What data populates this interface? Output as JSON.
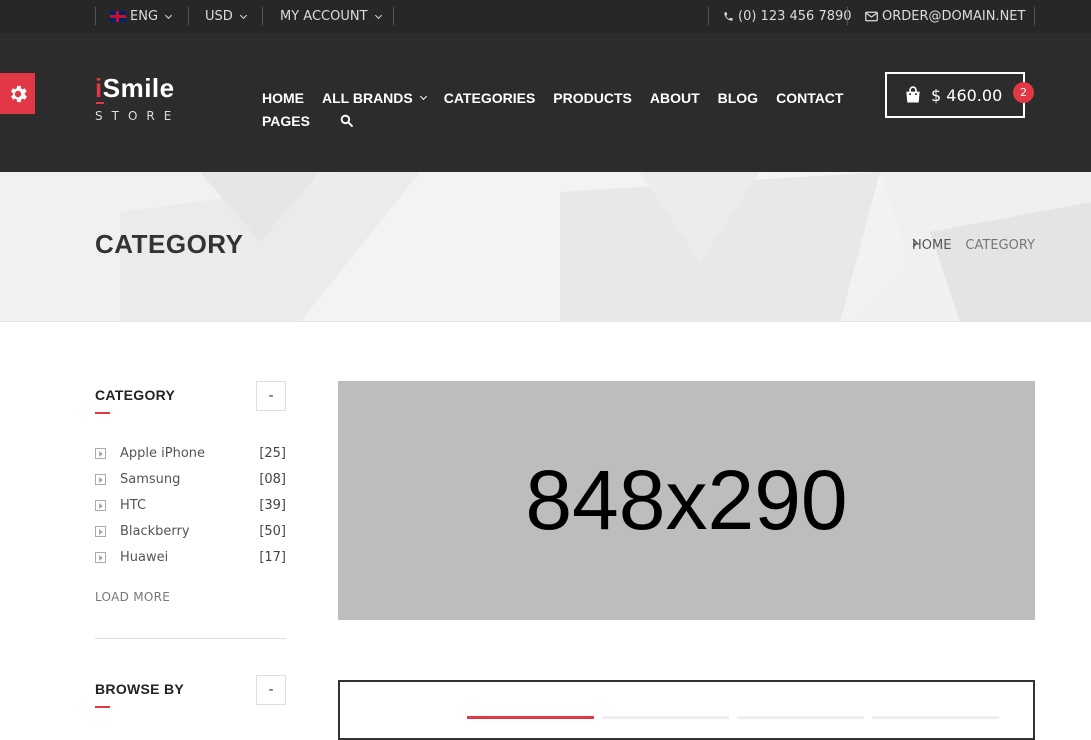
{
  "topbar": {
    "language": "ENG",
    "currency": "USD",
    "account": "MY ACCOUNT",
    "phone": "(0) 123 456 7890",
    "email": "ORDER@DOMAIN.NET"
  },
  "logo": {
    "i": "i",
    "rest": "Smile",
    "sub": "STORE"
  },
  "nav": {
    "row1": [
      "HOME",
      "ALL BRANDS",
      "CATEGORIES",
      "PRODUCTS",
      "ABOUT",
      "BLOG",
      "CONTACT"
    ],
    "row2": [
      "PAGES"
    ]
  },
  "cart": {
    "amount": "$ 460.00",
    "count": "2"
  },
  "banner": {
    "title": "CATEGORY",
    "breadcrumb": {
      "home": "HOME",
      "current": "CATEGORY"
    }
  },
  "sidebar": {
    "category": {
      "title": "CATEGORY",
      "toggle": "-",
      "items": [
        {
          "name": "Apple iPhone",
          "count": "[25]"
        },
        {
          "name": "Samsung",
          "count": "[08]"
        },
        {
          "name": "HTC",
          "count": "[39]"
        },
        {
          "name": "Blackberry",
          "count": "[50]"
        },
        {
          "name": "Huawei",
          "count": "[17]"
        }
      ],
      "load_more": "LOAD MORE"
    },
    "browse": {
      "title": "BROWSE BY",
      "toggle": "-"
    }
  },
  "main": {
    "placeholder": "848x290"
  },
  "colors": {
    "accent": "#e23744",
    "header_bg": "#2c2c2c",
    "topbar_bg": "#272727"
  }
}
